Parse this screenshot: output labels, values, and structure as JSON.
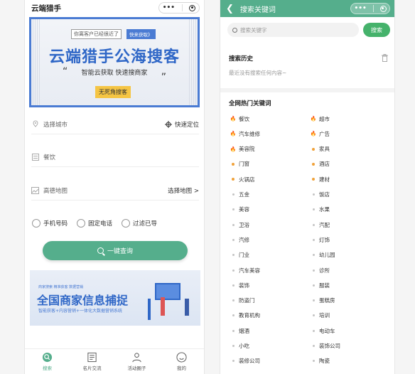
{
  "left": {
    "title": "云端猎手",
    "banner": {
      "hint": "你离客户已经很近了",
      "hint_btn": "快来获取》",
      "big": "云端猎手公海搜客",
      "sub": "智能云获取   快速搜商家",
      "quote_open": "“",
      "quote_close": "”",
      "tag": "无死角搜客"
    },
    "city_placeholder": "选择城市",
    "locate": "快速定位",
    "industry": "餐饮",
    "map": "高德地图",
    "map_select": "选择地图 >",
    "radios": [
      "手机号码",
      "固定电话",
      "过滤已导"
    ],
    "query_btn": "一键查询",
    "ad": {
      "small": "商家搜索  精准获客  数据营销",
      "big": "全国商家信息捕捉",
      "line": "智能获客+内容营销+一体化大数据营销系统"
    },
    "tabs": [
      "搜索",
      "名片交流",
      "活动圈子",
      "我的"
    ]
  },
  "right": {
    "title": "搜索关键词",
    "search_placeholder": "搜索关键字",
    "search_btn": "搜索",
    "history_title": "搜索历史",
    "history_empty": "最近没有搜索任何内容~",
    "hot_title": "全网热门关键词",
    "keywords_left": [
      {
        "t": "餐饮",
        "m": "flame"
      },
      {
        "t": "汽车维修",
        "m": "flame"
      },
      {
        "t": "美容院",
        "m": "flame"
      },
      {
        "t": "门窗",
        "m": "orange"
      },
      {
        "t": "火锅店",
        "m": "orange"
      },
      {
        "t": "五金",
        "m": "gray"
      },
      {
        "t": "美容",
        "m": "gray"
      },
      {
        "t": "卫浴",
        "m": "gray"
      },
      {
        "t": "汽修",
        "m": "gray"
      },
      {
        "t": "门业",
        "m": "gray"
      },
      {
        "t": "汽车美容",
        "m": "gray"
      },
      {
        "t": "装饰",
        "m": "gray"
      },
      {
        "t": "防盗门",
        "m": "gray"
      },
      {
        "t": "教育机构",
        "m": "gray"
      },
      {
        "t": "烟酒",
        "m": "gray"
      },
      {
        "t": "小吃",
        "m": "gray"
      },
      {
        "t": "装修公司",
        "m": "gray"
      }
    ],
    "keywords_right": [
      {
        "t": "超市",
        "m": "flame"
      },
      {
        "t": "广告",
        "m": "flame"
      },
      {
        "t": "家具",
        "m": "orange"
      },
      {
        "t": "酒店",
        "m": "orange"
      },
      {
        "t": "建材",
        "m": "orange"
      },
      {
        "t": "饭店",
        "m": "gray"
      },
      {
        "t": "水果",
        "m": "gray"
      },
      {
        "t": "汽配",
        "m": "gray"
      },
      {
        "t": "灯饰",
        "m": "gray"
      },
      {
        "t": "幼儿园",
        "m": "gray"
      },
      {
        "t": "诊所",
        "m": "gray"
      },
      {
        "t": "服装",
        "m": "gray"
      },
      {
        "t": "蛋糕房",
        "m": "gray"
      },
      {
        "t": "培训",
        "m": "gray"
      },
      {
        "t": "电动车",
        "m": "gray"
      },
      {
        "t": "装饰公司",
        "m": "gray"
      },
      {
        "t": "陶瓷",
        "m": "gray"
      }
    ]
  },
  "colors": {
    "accent": "#55ae8c",
    "brand_blue": "#2f67c7",
    "hot": "#e8432e"
  }
}
